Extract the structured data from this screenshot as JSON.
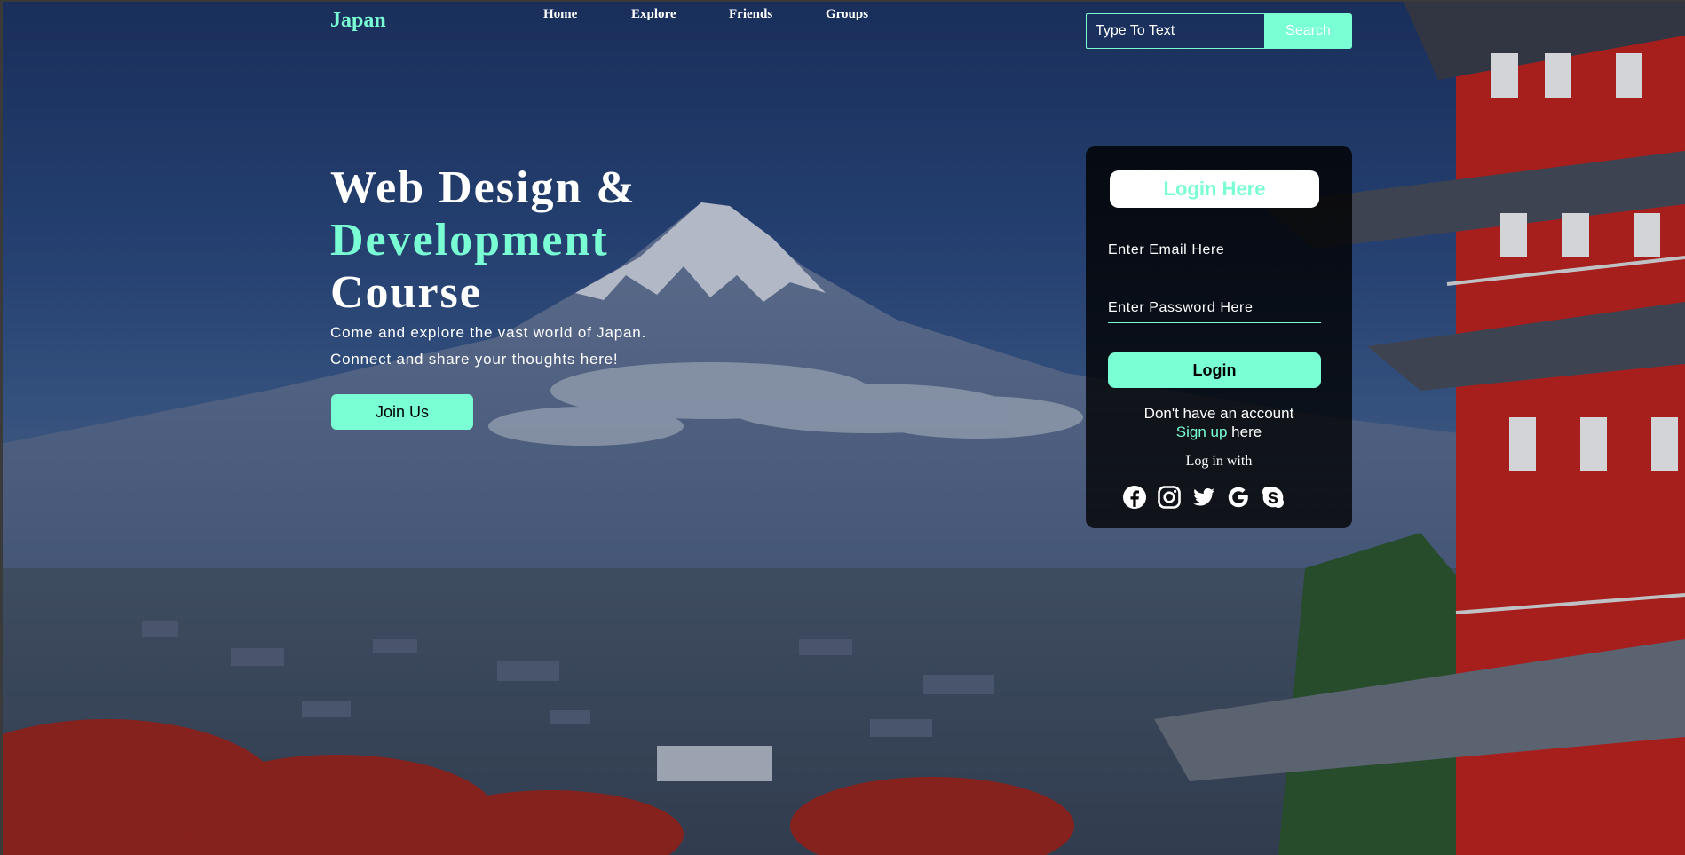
{
  "brand": {
    "logo": "Japan"
  },
  "nav": {
    "items": [
      "Home",
      "Explore",
      "Friends",
      "Groups"
    ]
  },
  "search": {
    "placeholder": "Type To Text",
    "button": "Search"
  },
  "hero": {
    "title_line1": "Web Design &",
    "title_line2": "Development",
    "title_line3": "Course",
    "desc_line1": "Come and explore the vast world of Japan.",
    "desc_line2": "Connect and share your thoughts here!",
    "cta": "Join Us"
  },
  "login": {
    "title": "Login Here",
    "email_placeholder": "Enter Email Here",
    "password_placeholder": "Enter Password Here",
    "button": "Login",
    "no_account": "Don't have an account",
    "signup_link": "Sign up",
    "signup_suffix": " here",
    "log_in_with": "Log in with",
    "social_icons": [
      "facebook-icon",
      "instagram-icon",
      "twitter-icon",
      "google-icon",
      "skype-icon"
    ]
  },
  "colors": {
    "accent": "#7affd4",
    "card_bg": "#000000",
    "text": "#ffffff"
  }
}
